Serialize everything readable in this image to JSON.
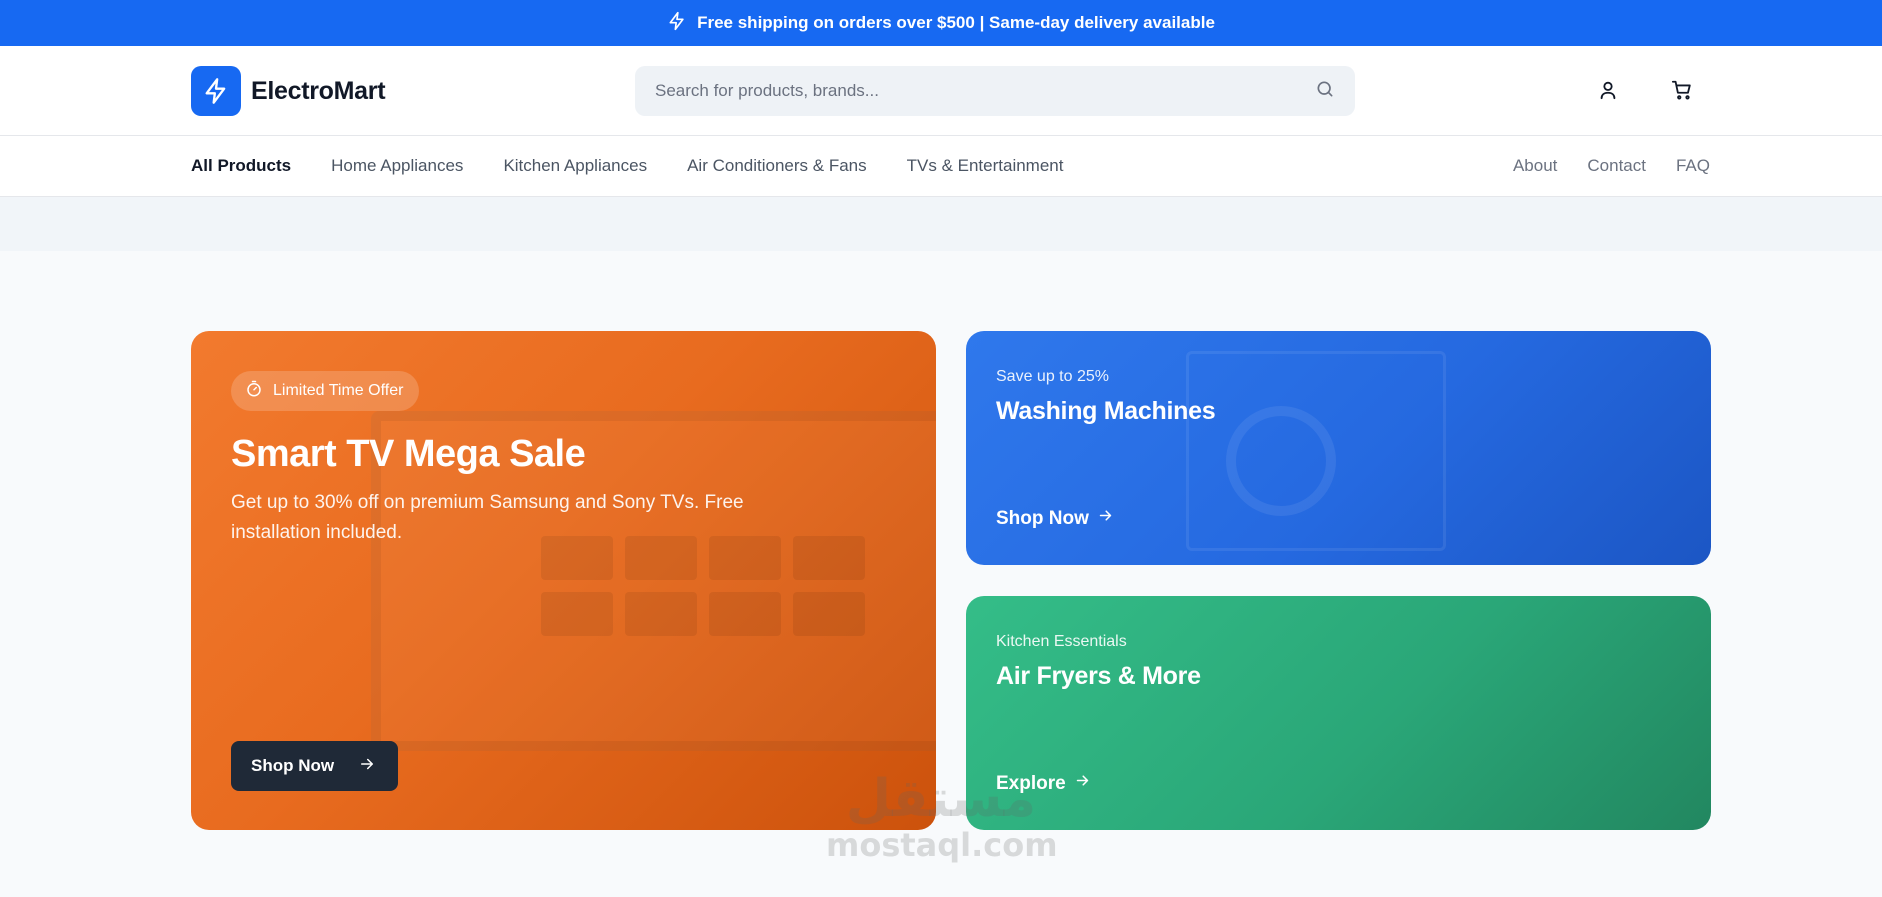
{
  "topbar": {
    "text": "Free shipping on orders over $500 | Same-day delivery available",
    "icon": "lightning-icon"
  },
  "header": {
    "brand": "ElectroMart",
    "search_placeholder": "Search for products, brands...",
    "icons": [
      "user-icon",
      "cart-icon"
    ]
  },
  "nav": {
    "categories": [
      "All Products",
      "Home Appliances",
      "Kitchen Appliances",
      "Air Conditioners & Fans",
      "TVs & Entertainment"
    ],
    "links": [
      "About",
      "Contact",
      "FAQ"
    ]
  },
  "hero": {
    "main": {
      "badge": "Limited Time Offer",
      "title": "Smart TV Mega Sale",
      "description": "Get up to 30% off on premium Samsung and Sony TVs. Free installation included.",
      "button": "Shop Now",
      "color": "#ea6f22"
    },
    "washing": {
      "eyebrow": "Save up to 25%",
      "title": "Washing Machines",
      "link": "Shop Now",
      "color": "#2569e0"
    },
    "kitchen": {
      "eyebrow": "Kitchen Essentials",
      "title": "Air Fryers & More",
      "link": "Explore",
      "color": "#2aa778"
    }
  },
  "watermark": {
    "arabic": "مستقل",
    "latin": "mostaql.com"
  },
  "colors": {
    "brand": "#1769f2",
    "dark_button": "#1f2937"
  }
}
